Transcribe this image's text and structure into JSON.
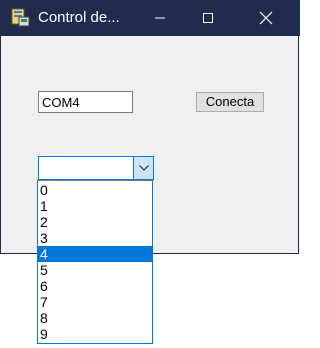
{
  "window": {
    "title": "Control de...",
    "minimize_label": "Minimize",
    "maximize_label": "Maximize",
    "close_label": "Close"
  },
  "form": {
    "port_value": "COM4",
    "connect_label": "Conecta"
  },
  "combo": {
    "value": "",
    "options": [
      "0",
      "1",
      "2",
      "3",
      "4",
      "5",
      "6",
      "7",
      "8",
      "9"
    ],
    "highlighted": "4"
  },
  "colors": {
    "titlebar": "#1f2c4d",
    "accent": "#0078d7",
    "window_bg": "#f0f0f0"
  },
  "icons": {
    "app": "app-icon",
    "minimize": "minimize-icon",
    "maximize": "maximize-icon",
    "close": "close-icon",
    "dropdown": "chevron-down-icon"
  }
}
